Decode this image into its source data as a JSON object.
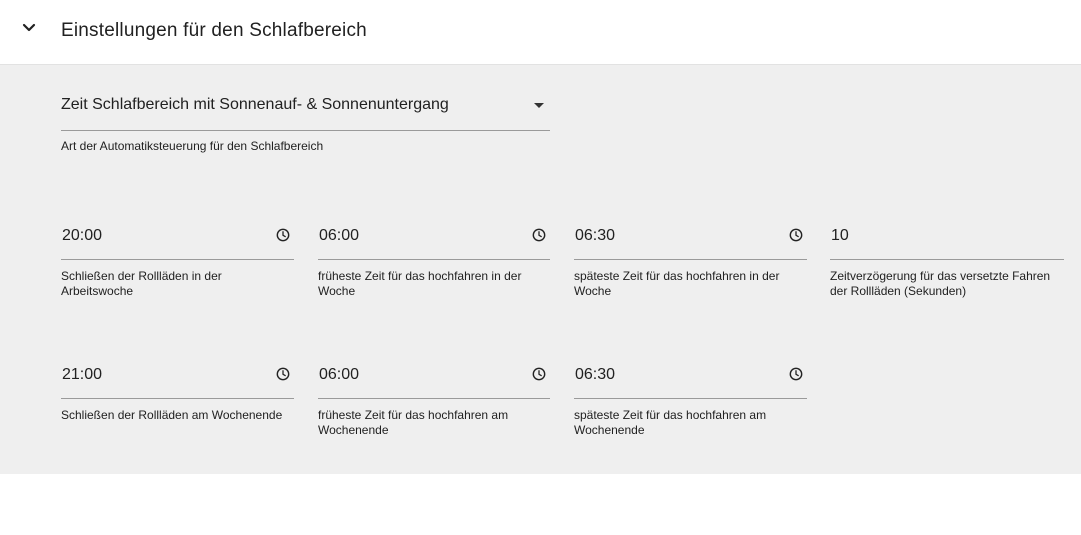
{
  "header": {
    "title": "Einstellungen für den Schlafbereich"
  },
  "mode_select": {
    "value": "Zeit Schlafbereich mit Sonnenauf- & Sonnenuntergang",
    "helper": "Art der Automatiksteuerung für den Schlafbereich"
  },
  "fields": [
    {
      "value": "20:00",
      "helper": "Schließen der Rollläden in der Arbeitswoche",
      "icon": "clock-icon"
    },
    {
      "value": "06:00",
      "helper": "früheste Zeit für das hochfahren in der Woche",
      "icon": "clock-icon"
    },
    {
      "value": "06:30",
      "helper": "späteste Zeit für das hochfahren in der Woche",
      "icon": "clock-icon"
    },
    {
      "value": "10",
      "helper": "Zeitverzögerung für das versetzte Fahren der Rollläden (Sekunden)"
    },
    {
      "value": "21:00",
      "helper": "Schließen der Rollläden am Wochenende",
      "icon": "clock-icon"
    },
    {
      "value": "06:00",
      "helper": "früheste Zeit für das hochfahren am Wochenende",
      "icon": "clock-icon"
    },
    {
      "value": "06:30",
      "helper": "späteste Zeit für das hochfahren am Wochenende",
      "icon": "clock-icon"
    }
  ]
}
